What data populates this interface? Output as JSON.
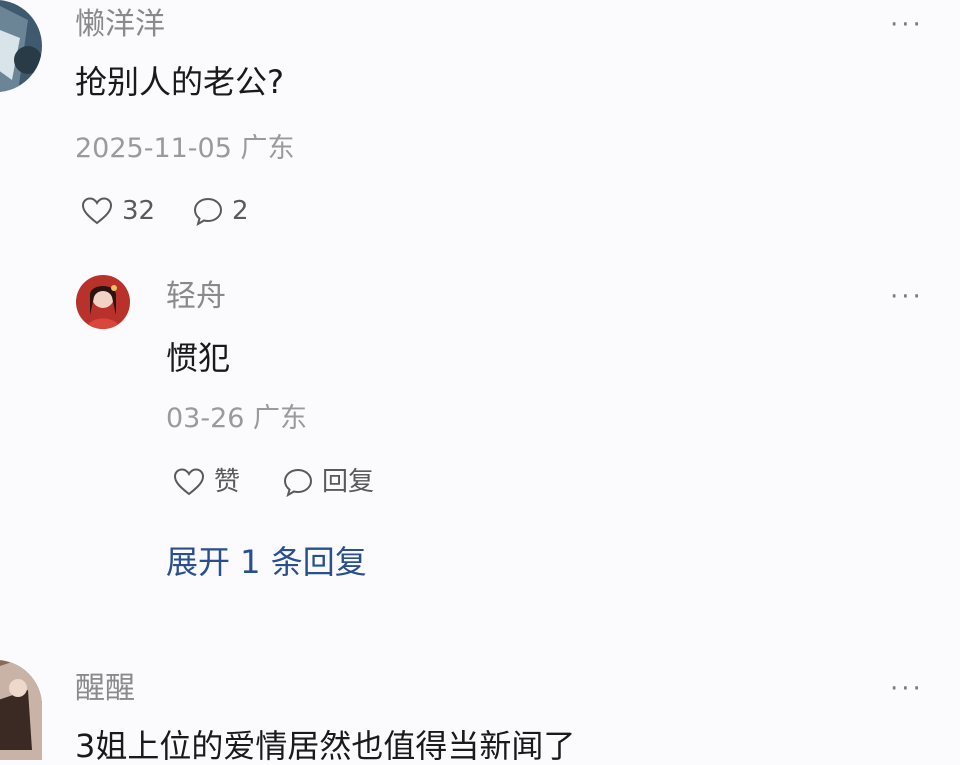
{
  "comments": [
    {
      "author": "懒洋洋",
      "text": "抢别人的老公?",
      "date_location": "2025-11-05 广东",
      "likes": "32",
      "replies": "2",
      "more": "···",
      "reply": {
        "author": "轻舟",
        "text": "惯犯",
        "date_location": "03-26 广东",
        "like_label": "赞",
        "reply_label": "回复",
        "more": "···"
      },
      "expand_label": "展开 1 条回复"
    },
    {
      "author": "醒醒",
      "text": "3姐上位的爱情居然也值得当新闻了",
      "more": "···"
    }
  ],
  "icons": {
    "like": "heart-outline-icon",
    "comment": "speech-bubble-icon",
    "more": "more-horizontal-icon"
  },
  "colors": {
    "background": "#fbfbfd",
    "expand_link": "#2a4f8f",
    "muted_text": "#9a9a9e"
  }
}
